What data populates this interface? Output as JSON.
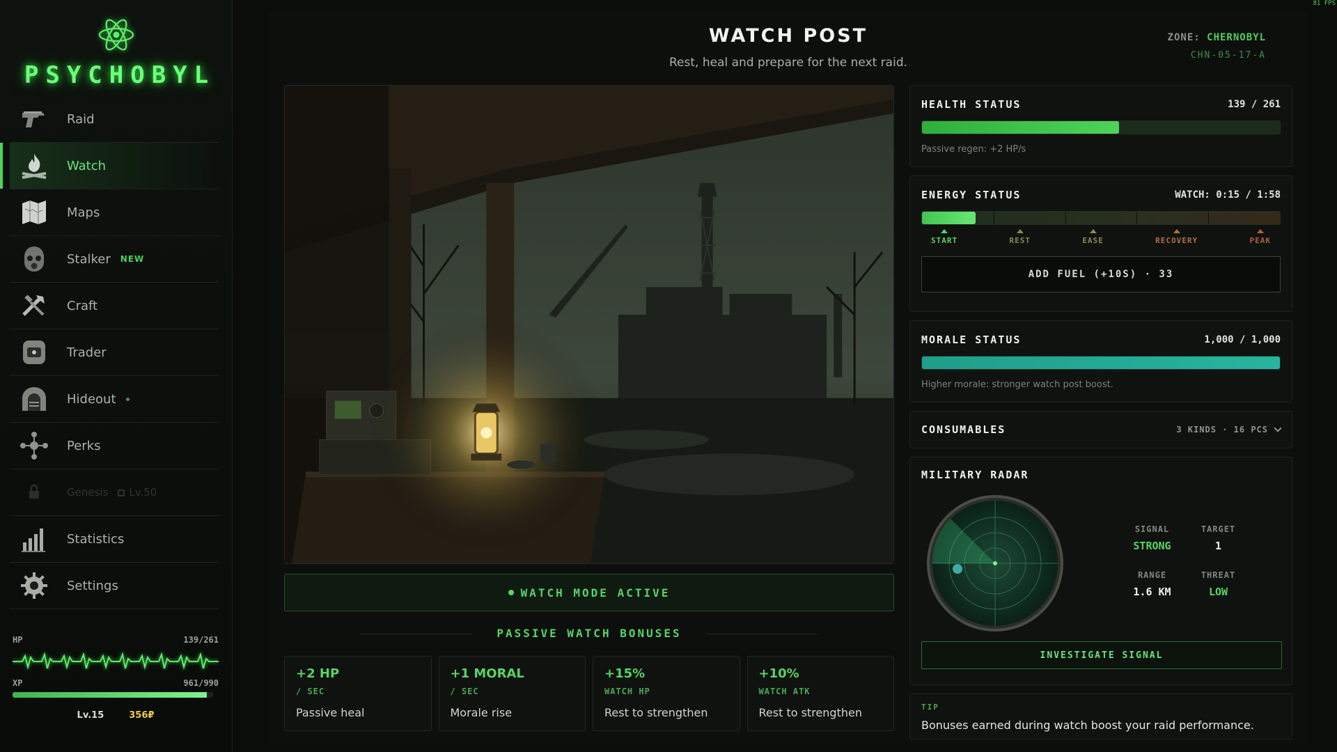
{
  "app": {
    "name": "PSYCHOBYL",
    "fps": "81 FPS"
  },
  "sidebar": {
    "items": [
      {
        "label": "Raid",
        "icon": "pistol-icon"
      },
      {
        "label": "Watch",
        "icon": "campfire-icon",
        "active": true
      },
      {
        "label": "Maps",
        "icon": "map-icon"
      },
      {
        "label": "Stalker",
        "icon": "stalker-mask-icon",
        "badge": "NEW"
      },
      {
        "label": "Craft",
        "icon": "tools-icon"
      },
      {
        "label": "Trader",
        "icon": "trader-icon"
      },
      {
        "label": "Hideout",
        "icon": "bunker-icon",
        "dot": true
      },
      {
        "label": "Perks",
        "icon": "perks-icon"
      },
      {
        "label": "Genesis",
        "icon": "lock-icon",
        "locked": true,
        "lock_level": "Lv.50"
      },
      {
        "label": "Statistics",
        "icon": "bar-chart-icon"
      },
      {
        "label": "Settings",
        "icon": "gear-icon"
      }
    ],
    "vitals": {
      "hp_label": "HP",
      "hp_value": "139/261",
      "xp_label": "XP",
      "xp_value": "961/990",
      "xp_fraction": 0.97,
      "level": "Lv.15",
      "money": "356₽"
    }
  },
  "main": {
    "title": "WATCH POST",
    "subtitle": "Rest, heal and prepare for the next raid.",
    "zone_label": "ZONE:",
    "zone_value": "CHERNOBYL",
    "zone_code": "CHN-05-17-A",
    "watch_mode": "WATCH MODE ACTIVE",
    "bonus_title": "PASSIVE WATCH BONUSES",
    "bonuses": [
      {
        "value": "+2 HP",
        "unit": "/ SEC",
        "desc": "Passive heal"
      },
      {
        "value": "+1 MORAL",
        "unit": "/ SEC",
        "desc": "Morale rise"
      },
      {
        "value": "+15%",
        "unit": "WATCH HP",
        "desc": "Rest to strengthen"
      },
      {
        "value": "+10%",
        "unit": "WATCH ATK",
        "desc": "Rest to strengthen"
      }
    ]
  },
  "health": {
    "title": "HEALTH STATUS",
    "value": "139 / 261",
    "fraction": 0.55,
    "note": "Passive regen: +2 HP/s",
    "color": "#4ed35a"
  },
  "energy": {
    "title": "ENERGY STATUS",
    "value": "WATCH: 0:15 / 1:58",
    "fraction": 0.15,
    "phases": [
      {
        "label": "START",
        "color": "#58d465"
      },
      {
        "label": "REST",
        "color": "#7a8f4a"
      },
      {
        "label": "EASE",
        "color": "#8f8a4a"
      },
      {
        "label": "RECOVERY",
        "color": "#b0703a"
      },
      {
        "label": "PEAK",
        "color": "#b0603a"
      }
    ],
    "fuel_button": "ADD FUEL (+10S) · 33"
  },
  "morale": {
    "title": "MORALE STATUS",
    "value": "1,000 / 1,000",
    "fraction": 1.0,
    "note": "Higher morale: stronger watch post boost.",
    "color": "#26b5a0"
  },
  "consumables": {
    "title": "CONSUMABLES",
    "summary": "3 KINDS · 16 PCS"
  },
  "radar": {
    "title": "MILITARY RADAR",
    "signal_label": "SIGNAL",
    "signal_value": "STRONG",
    "target_label": "TARGET",
    "target_value": "1",
    "range_label": "RANGE",
    "range_value": "1.6 KM",
    "threat_label": "THREAT",
    "threat_value": "LOW",
    "button": "INVESTIGATE SIGNAL"
  },
  "tip": {
    "label": "TIP",
    "text": "Bonuses earned during watch boost your raid performance."
  }
}
